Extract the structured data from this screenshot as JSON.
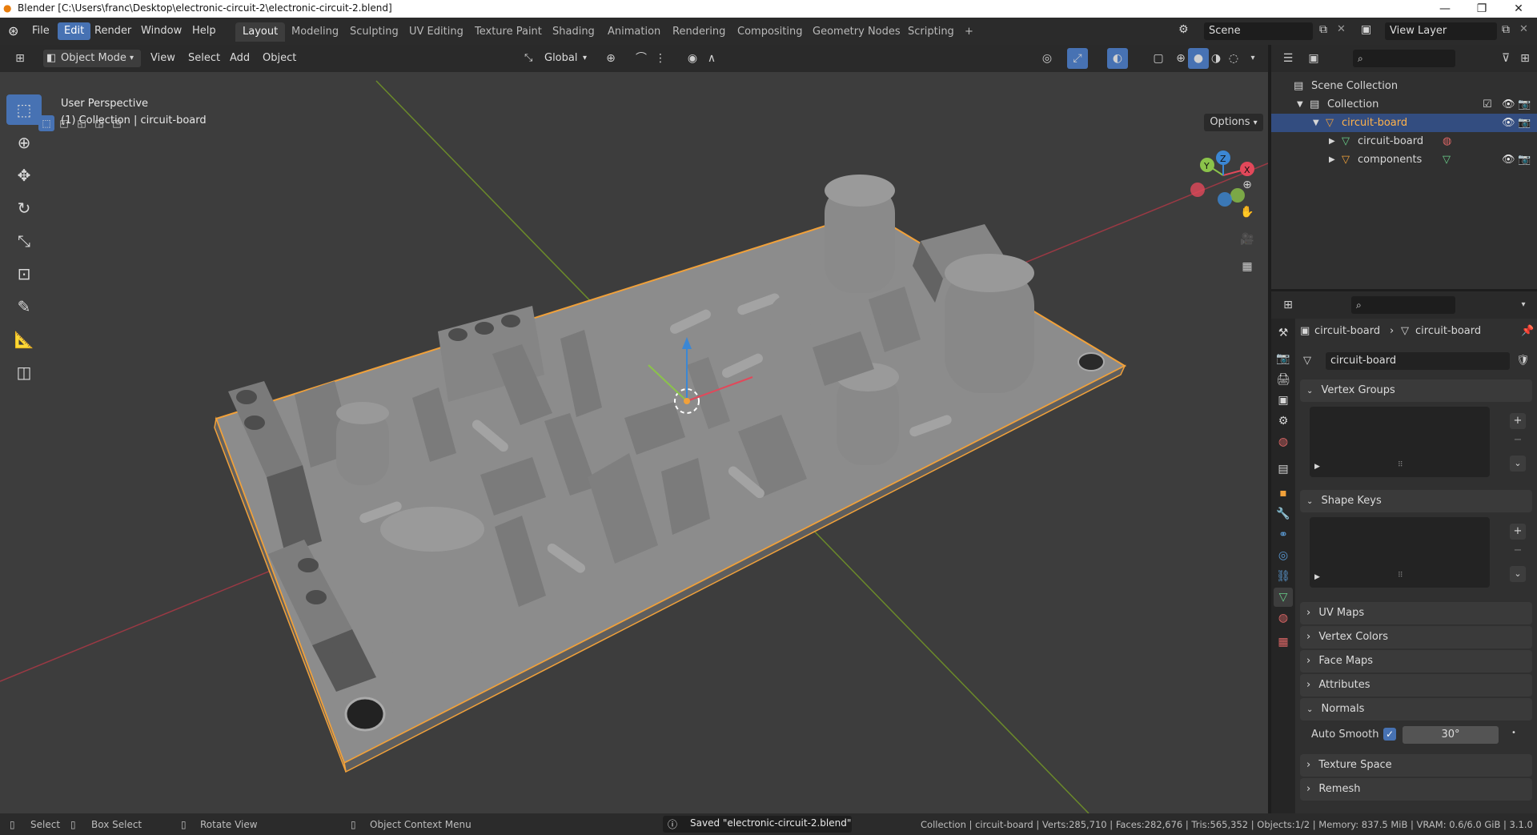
{
  "titlebar": {
    "title": "Blender [C:\\Users\\franc\\Desktop\\electronic-circuit-2\\electronic-circuit-2.blend]",
    "minimize": "—",
    "maximize": "❐",
    "close": "✕"
  },
  "menu": {
    "file": "File",
    "edit": "Edit",
    "render": "Render",
    "window": "Window",
    "help": "Help"
  },
  "workspaces": [
    "Layout",
    "Modeling",
    "Sculpting",
    "UV Editing",
    "Texture Paint",
    "Shading",
    "Animation",
    "Rendering",
    "Compositing",
    "Geometry Nodes",
    "Scripting"
  ],
  "add_workspace": "+",
  "scene": {
    "scene_name": "Scene",
    "view_layer": "View Layer"
  },
  "viewport": {
    "mode": "Object Mode",
    "menus": {
      "view": "View",
      "select": "Select",
      "add": "Add",
      "object": "Object"
    },
    "transform_orientation": "Global",
    "options": "Options",
    "overlay_title": "User Perspective",
    "overlay_subtitle": "(1) Collection | circuit-board",
    "gizmo": {
      "x": "X",
      "y": "Y",
      "z": "Z"
    }
  },
  "outliner": {
    "scene_collection": "Scene Collection",
    "collection": "Collection",
    "items": [
      {
        "label": "circuit-board"
      },
      {
        "label": "circuit-board"
      },
      {
        "label": "components"
      }
    ]
  },
  "properties": {
    "breadcrumb_obj": "circuit-board",
    "breadcrumb_mesh": "circuit-board",
    "mesh_name": "circuit-board",
    "panels": {
      "vertex_groups": "Vertex Groups",
      "shape_keys": "Shape Keys",
      "uv_maps": "UV Maps",
      "vertex_colors": "Vertex Colors",
      "face_maps": "Face Maps",
      "attributes": "Attributes",
      "normals": "Normals",
      "texture_space": "Texture Space",
      "remesh": "Remesh"
    },
    "auto_smooth_label": "Auto Smooth",
    "auto_smooth_angle": "30°"
  },
  "statusbar": {
    "select": "Select",
    "box_select": "Box Select",
    "rotate_view": "Rotate View",
    "context_menu": "Object Context Menu",
    "message": "Saved \"electronic-circuit-2.blend\"",
    "stats": "Collection | circuit-board | Verts:285,710 | Faces:282,676 | Tris:565,352 | Objects:1/2 | Memory: 837.5 MiB | VRAM: 0.6/6.0 GiB | 3.1.0"
  },
  "colors": {
    "accent": "#4772b3",
    "selection": "#f1a13a",
    "x_axis": "#e2485a",
    "y_axis": "#8bc34a",
    "z_axis": "#3b87d4"
  }
}
